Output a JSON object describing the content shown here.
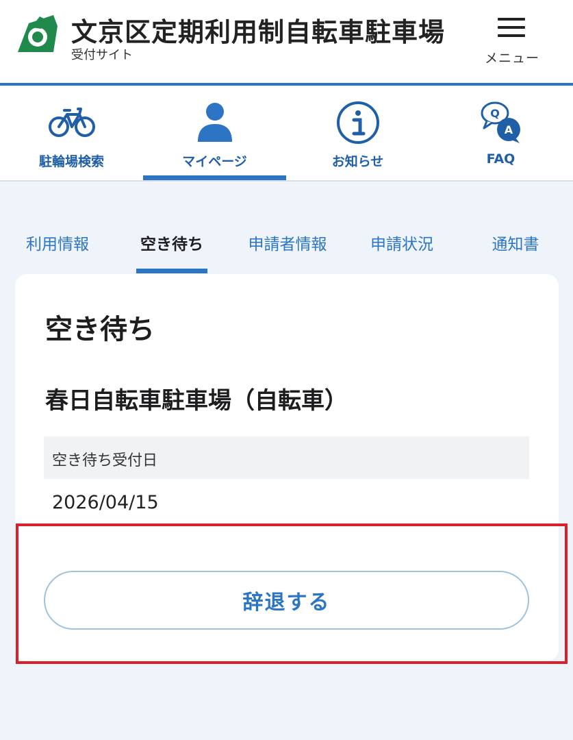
{
  "header": {
    "title": "文京区定期利用制自転車駐車場",
    "subtitle": "受付サイト",
    "menu_label": "メニュー"
  },
  "nav": {
    "items": [
      {
        "label": "駐輪場検索",
        "icon": "bicycle-icon"
      },
      {
        "label": "マイページ",
        "icon": "user-icon",
        "active": true
      },
      {
        "label": "お知らせ",
        "icon": "info-icon"
      },
      {
        "label": "FAQ",
        "icon": "qa-icon"
      }
    ]
  },
  "sub_tabs": [
    {
      "label": "利用情報"
    },
    {
      "label": "空き待ち",
      "active": true
    },
    {
      "label": "申請者情報"
    },
    {
      "label": "申請状況"
    },
    {
      "label": "通知書"
    }
  ],
  "card": {
    "title": "空き待ち",
    "facility": "春日自転車駐車場（自転車）",
    "field_label": "空き待ち受付日",
    "field_value": "2026/04/15",
    "button_label": "辞退する"
  },
  "colors": {
    "accent": "#2c75c4",
    "logo_green": "#1f8a4c",
    "highlight": "#d9202b",
    "background": "#eff4fb"
  }
}
